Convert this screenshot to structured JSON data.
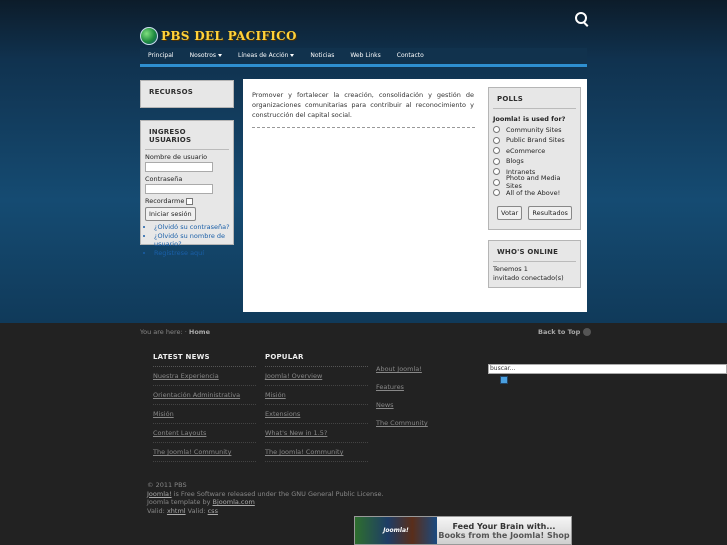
{
  "site": {
    "logo_text": "PBS DEL PACIFICO"
  },
  "nav": {
    "items": [
      {
        "label": "Principal",
        "caret": false
      },
      {
        "label": "Nosotros",
        "caret": true
      },
      {
        "label": "Líneas de Acción",
        "caret": true
      },
      {
        "label": "Noticias",
        "caret": false
      },
      {
        "label": "Web Links",
        "caret": false
      },
      {
        "label": "Contacto",
        "caret": false
      }
    ]
  },
  "recursos": {
    "title": "RECURSOS"
  },
  "login": {
    "title": "INGRESO USUARIOS",
    "username_label": "Nombre de usuario",
    "password_label": "Contraseña",
    "remember_label": "Recordarme",
    "submit_label": "Iniciar sesión",
    "links": [
      "¿Olvidó su contraseña?",
      "¿Olvidó su nombre de usuario?",
      "Regístrese aquí"
    ]
  },
  "main": {
    "intro": "Promover y fortalecer la creación, consolidación y gestión de organizaciones comunitarias para contribuir al reconocimiento y construcción del capital social."
  },
  "polls": {
    "title": "POLLS",
    "question": "Joomla! is used for?",
    "options": [
      "Community Sites",
      "Public Brand Sites",
      "eCommerce",
      "Blogs",
      "Intranets",
      "Photo and Media Sites",
      "All of the Above!"
    ],
    "vote_label": "Votar",
    "results_label": "Resultados"
  },
  "whos_online": {
    "title": "WHO'S ONLINE",
    "line1": "Tenemos 1",
    "line2": "invitado conectado(s)"
  },
  "footer": {
    "breadcrumb_prefix": "You are here:",
    "breadcrumb_current": "Home",
    "back_to_top": "Back to Top",
    "latest": {
      "title": "LATEST NEWS",
      "links": [
        "Nuestra Experiencia",
        "Orientación Administrativa",
        "Misión",
        "Content Layouts",
        "The Joomla! Community"
      ]
    },
    "popular": {
      "title": "POPULAR",
      "links": [
        "Joomla! Overview",
        "Misión",
        "Extensions",
        "What's New in 1.5?",
        "The Joomla! Community"
      ]
    },
    "col3": {
      "links": [
        "About Joomla!",
        "Features",
        "News",
        "The Community"
      ]
    },
    "search_value": "buscar...",
    "copyright": {
      "line1": "© 2011 PBS",
      "joomla": "Joomla!",
      "line2_rest": " is Free Software released under the GNU General Public License.",
      "template_prefix": "Joomla template by ",
      "template_link": "Bjoomla.com",
      "valid_label": "Valid:",
      "xhtml": "xhtml",
      "valid2": "Valid:",
      "css": "css"
    },
    "banner": {
      "books_text": "Joomla!",
      "line1": "Feed Your Brain with...",
      "line2": "Books from the Joomla! Shop"
    }
  }
}
